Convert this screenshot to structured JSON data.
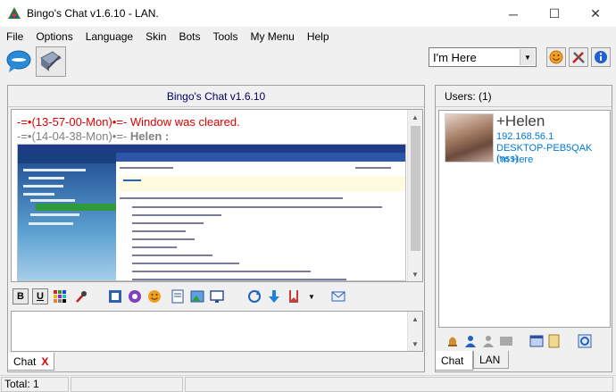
{
  "window": {
    "title": "Bingo's Chat v1.6.10 - LAN.",
    "minimize": "─",
    "maximize": "☐",
    "close": "✕"
  },
  "menu": [
    "File",
    "Options",
    "Language",
    "Skin",
    "Bots",
    "Tools",
    "My Menu",
    "Help"
  ],
  "toolbar": {
    "status_value": "I'm Here",
    "icons": [
      "chat-bubble-icon",
      "broadcast-pen-icon",
      "smile-icon",
      "settings-tools-icon",
      "info-icon"
    ]
  },
  "chat": {
    "header": "Bingo's Chat v1.6.10",
    "lines": [
      {
        "text": "-=•(13-57-00-Mon)•=- Window was cleared.",
        "color": "#e00000"
      },
      {
        "prefix": "-=•(14-04-38-Mon)•=- ",
        "user": "Helen :",
        "color": "#808080"
      }
    ],
    "format_buttons": [
      "B",
      "U"
    ],
    "tab_label": "Chat",
    "tab_close": "X"
  },
  "users": {
    "header": "Users: (1)",
    "list": [
      {
        "name": "+Helen",
        "ip": "192.168.56.1",
        "host": "DESKTOP-PEB5QAK (nss)",
        "status": "I'm Here"
      }
    ],
    "tabs": [
      "Chat",
      "LAN"
    ]
  },
  "statusbar": {
    "total": "Total: 1"
  },
  "colors": {
    "accent_blue": "#0078d7",
    "message_red": "#e00000",
    "header_navy": "#000060"
  }
}
